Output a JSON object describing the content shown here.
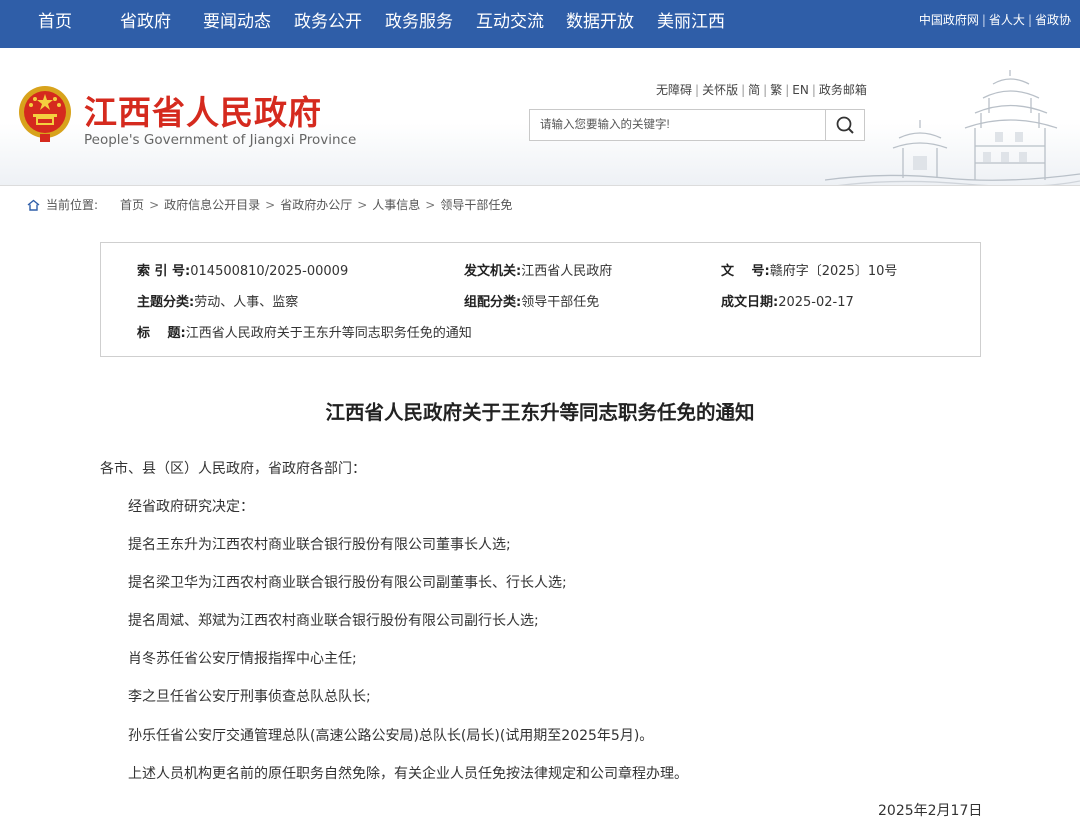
{
  "topnav": {
    "items": [
      "首页",
      "省政府",
      "要闻动态",
      "政务公开",
      "政务服务",
      "互动交流",
      "数据开放",
      "美丽江西"
    ],
    "links": [
      "中国政府网",
      "省人大",
      "省政协"
    ],
    "separator": "|"
  },
  "header": {
    "title_cn": "江西省人民政府",
    "title_en": "People's Government of Jiangxi Province",
    "small_links": [
      "无障碍",
      "关怀版",
      "简",
      "繁",
      "EN",
      "政务邮箱"
    ],
    "search_placeholder": "请输入您要输入的关键字!"
  },
  "breadcrumb": {
    "label": "当前位置:",
    "items": [
      "首页",
      "政府信息公开目录",
      "省政府办公厅",
      "人事信息",
      "领导干部任免"
    ],
    "arrow": ">"
  },
  "info": {
    "index_key": "索 引 号:",
    "index_val": "014500810/2025-00009",
    "issuer_key": "发文机关:",
    "issuer_val": "江西省人民政府",
    "docno_key": "文　 号:",
    "docno_val": "赣府字〔2025〕10号",
    "topic_key": "主题分类:",
    "topic_val": "劳动、人事、监察",
    "category_key": "组配分类:",
    "category_val": "领导干部任免",
    "date_key": "成文日期:",
    "date_val": "2025-02-17",
    "title_key": "标　 题:",
    "title_val": "江西省人民政府关于王东升等同志职务任免的通知"
  },
  "article": {
    "title": "江西省人民政府关于王东升等同志职务任免的通知",
    "salutation": "各市、县（区）人民政府，省政府各部门：",
    "paragraphs": [
      "经省政府研究决定：",
      "提名王东升为江西农村商业联合银行股份有限公司董事长人选;",
      "提名梁卫华为江西农村商业联合银行股份有限公司副董事长、行长人选;",
      "提名周斌、郑斌为江西农村商业联合银行股份有限公司副行长人选;",
      "肖冬苏任省公安厅情报指挥中心主任;",
      "李之旦任省公安厅刑事侦查总队总队长;",
      "孙乐任省公安厅交通管理总队(高速公路公安局)总队长(局长)(试用期至2025年5月)。",
      "上述人员机构更名前的原任职务自然免除，有关企业人员任免按法律规定和公司章程办理。"
    ],
    "date": "2025年2月17日"
  },
  "colors": {
    "nav_bg": "#2f5ea8",
    "title_red": "#d52a1e"
  }
}
